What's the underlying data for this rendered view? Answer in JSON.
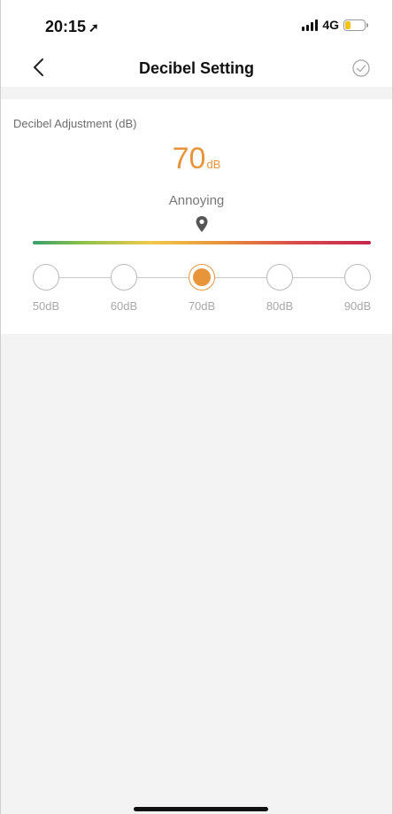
{
  "status_bar": {
    "time": "20:15",
    "network": "4G"
  },
  "nav": {
    "title": "Decibel Setting",
    "back_icon": "chevron-left-icon",
    "confirm_icon": "check-circle-icon"
  },
  "decibel": {
    "section_label": "Decibel Adjustment (dB)",
    "current_value": "70",
    "current_unit": "dB",
    "level_name": "Annoying",
    "accent_color": "#e8943a",
    "steps": [
      "50dB",
      "60dB",
      "70dB",
      "80dB",
      "90dB"
    ],
    "selected_index": 2
  }
}
